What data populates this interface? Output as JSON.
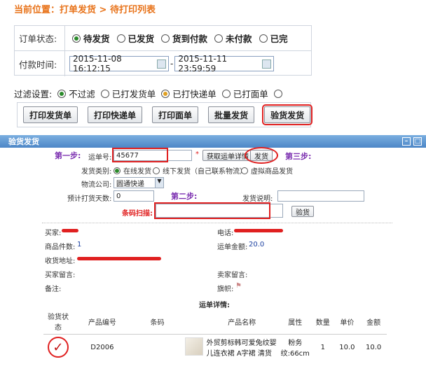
{
  "breadcrumb": "当前位置：打单发货 > 待打印列表",
  "order_status": {
    "label": "订单状态:",
    "options": [
      "待发货",
      "已发货",
      "货到付款",
      "未付款",
      "已完"
    ],
    "selected": 0
  },
  "pay_time": {
    "label": "付款时间:",
    "start": "2015-11-08 16:12:15",
    "end": "2015-11-11 23:59:59",
    "sep": "-"
  },
  "filter": {
    "label": "过滤设置:",
    "options": [
      "不过滤",
      "已打发货单",
      "已打快递单",
      "已打面单",
      ""
    ],
    "selected": 0
  },
  "buttons": [
    "打印发货单",
    "打印快递单",
    "打印面单",
    "批量发货",
    "验货发货"
  ],
  "dialog": {
    "title": "验货发货",
    "step1": "第一步:",
    "step2": "第二步:",
    "step3": "第三步:",
    "tracking_label": "运单号:",
    "tracking_value": "45677",
    "required_mark": "*",
    "get_detail_btn": "获取运单详情",
    "ship_btn": "发货",
    "ship_type_label": "发货类别:",
    "ship_types": [
      "在线发货",
      "线下发货（自己联系物流）",
      "虚拟商品发货"
    ],
    "logistics_label": "物流公司:",
    "logistics_value": "圆通快递",
    "days_label": "预计打货天数:",
    "days_value": "0",
    "note_label": "发货说明:",
    "barcode_label": "条码扫描:",
    "verify_btn": "验货",
    "buyer_label": "买家:",
    "phone_label": "电话:",
    "qty_label": "商品件数:",
    "qty_value": "1",
    "amount_label": "运单金额:",
    "amount_value": "20.0",
    "address_label": "收货地址:",
    "buyer_msg_label": "买家留言:",
    "seller_msg_label": "卖家留言:",
    "remark_label": "备注:",
    "flag_label": "旗帜:",
    "detail_title": "运单详情:",
    "table": {
      "headers": [
        "验货状态",
        "产品编号",
        "条码",
        "",
        "产品名称",
        "属性",
        "数量",
        "单价",
        "金额"
      ],
      "rows": [
        {
          "code": "D2006",
          "barcode": "",
          "name": "外贸剪标韩可爱兔纹婴儿连衣裙 A字裙 清货",
          "attr": "粉务纹:66cm",
          "qty": "1",
          "price": "10.0",
          "amount": "10.0"
        }
      ]
    }
  }
}
